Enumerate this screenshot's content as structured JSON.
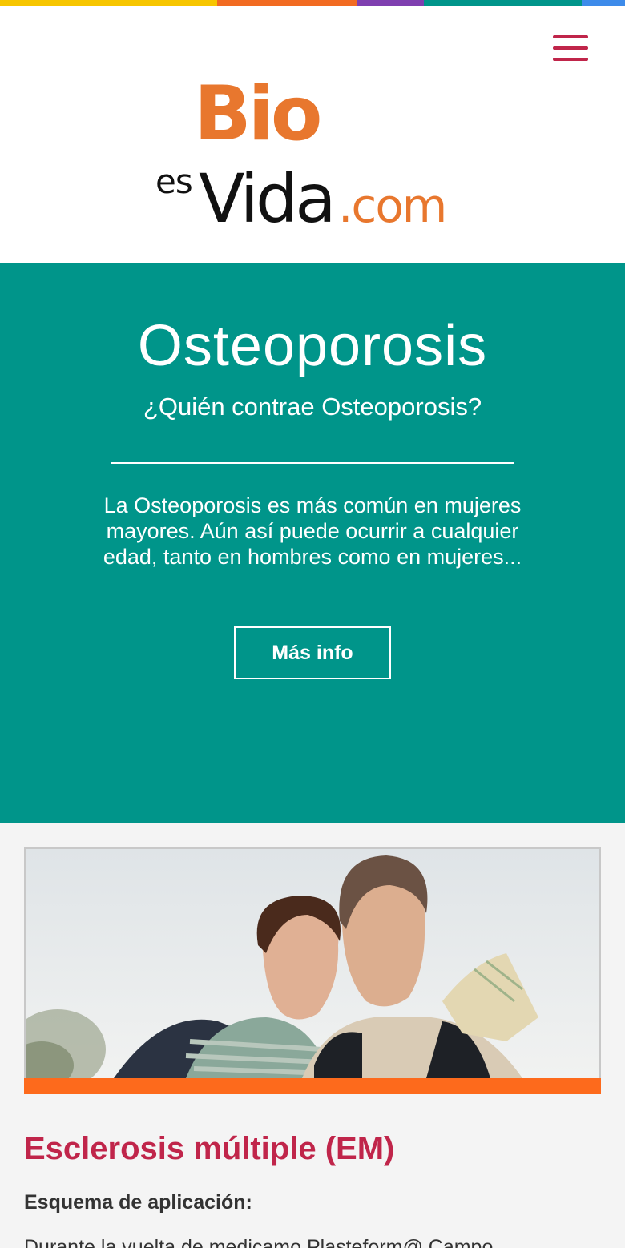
{
  "colors": {
    "stripe": [
      "#f7c600",
      "#f26b21",
      "#7f3fb0",
      "#00958a",
      "#3d8bea"
    ],
    "teal": "#00958a",
    "accent_red": "#c0254a",
    "logo_orange": "#e8772e",
    "logo_black": "#111111",
    "orange_bar": "#fd6a1c",
    "page_bg": "#f4f4f4"
  },
  "header": {
    "menu_icon": "hamburger-menu-icon",
    "logo": {
      "bio": "Bio",
      "es": "es",
      "vida": "Vida",
      "dotcom": ".com"
    }
  },
  "hero": {
    "title": "Osteoporosis",
    "subtitle": "¿Quién contrae Osteoporosis?",
    "description": "La Osteoporosis es más común en mujeres mayores. Aún así puede ocurrir a cualquier edad, tanto en hombres como en mujeres...",
    "button_label": "Más info"
  },
  "article": {
    "image_subject": "couple-hiking-photo",
    "title": "Esclerosis múltiple (EM)",
    "subtitle": "Esquema de aplicación:",
    "body": "Durante la vuelta de medicamo Plasteform@ Campo..."
  }
}
